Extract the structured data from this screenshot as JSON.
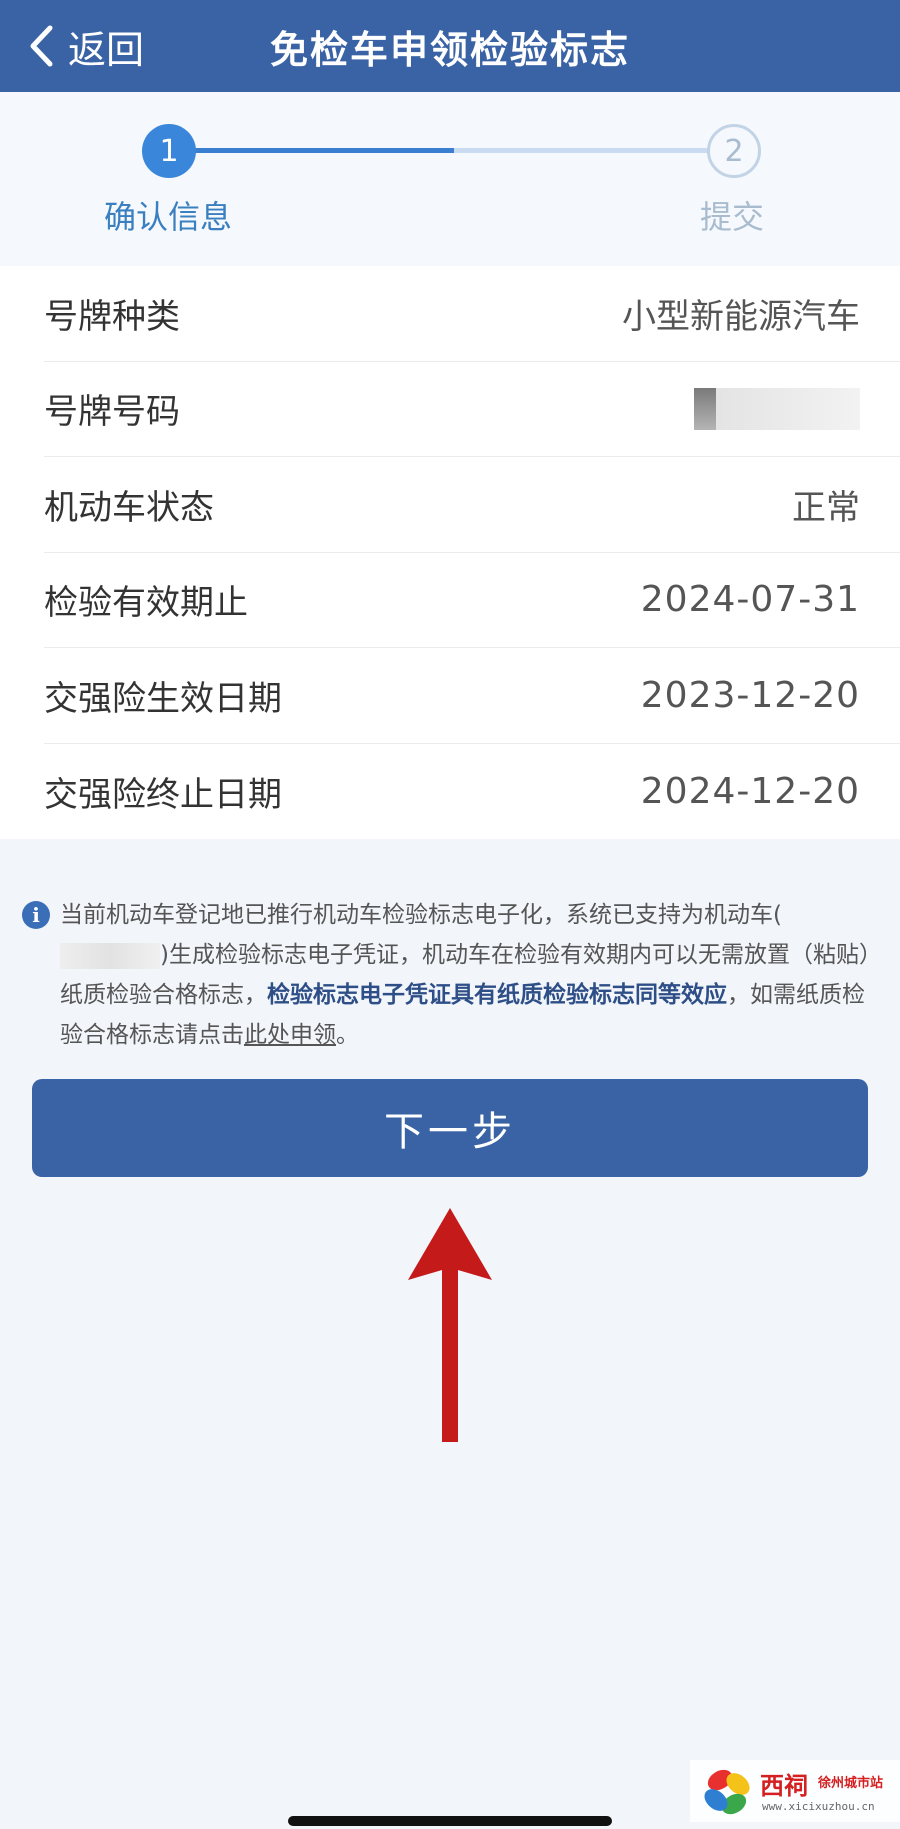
{
  "header": {
    "back_label": "返回",
    "title": "免检车申领检验标志",
    "bg_color": "#3a63a5"
  },
  "stepper": {
    "steps": [
      {
        "number": "1",
        "label": "确认信息",
        "state": "active"
      },
      {
        "number": "2",
        "label": "提交",
        "state": "inactive"
      }
    ]
  },
  "vehicle_info": {
    "rows": [
      {
        "label": "号牌种类",
        "value": "小型新能源汽车"
      },
      {
        "label": "号牌号码",
        "value": ""
      },
      {
        "label": "机动车状态",
        "value": "正常"
      },
      {
        "label": "检验有效期止",
        "value": "2024-07-31"
      },
      {
        "label": "交强险生效日期",
        "value": "2023-12-20"
      },
      {
        "label": "交强险终止日期",
        "value": "2024-12-20"
      }
    ]
  },
  "notice": {
    "icon": "info-icon",
    "text_part1": "当前机动车登记地已推行机动车检验标志电子化，系统已支持为机动车(",
    "text_part2": ")生成检验标志电子凭证，机动车在检验有效期内可以无需放置（粘贴）纸质检验合格标志，",
    "text_bold": "检验标志电子凭证具有纸质检验标志同等效应",
    "text_part3": "，如需纸质检验合格标志请点击",
    "link_label": "此处申领",
    "text_end": "。"
  },
  "next_button": {
    "label": "下一步"
  },
  "annotation": {
    "arrow_color": "#c41a1a"
  },
  "watermark": {
    "cn": "西祠",
    "sub": "徐州城市站",
    "url": "www.xicixuzhou.cn"
  }
}
